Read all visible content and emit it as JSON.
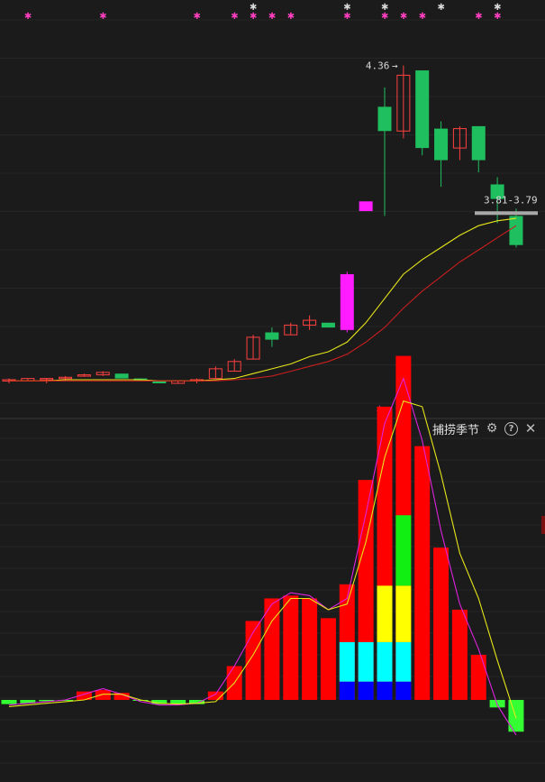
{
  "sub_panel": {
    "title": "捕捞季节"
  },
  "annotations": {
    "high_label": "4.36",
    "range_label": "3.81-3.79"
  },
  "chart_data": [
    {
      "type": "candlestick",
      "ylim": [
        3.05,
        4.5
      ],
      "candles": [
        {
          "o": 3.06,
          "h": 3.07,
          "l": 3.05,
          "c": 3.065
        },
        {
          "o": 3.06,
          "h": 3.07,
          "l": 3.06,
          "c": 3.07
        },
        {
          "o": 3.07,
          "h": 3.07,
          "l": 3.05,
          "c": 3.07
        },
        {
          "o": 3.07,
          "h": 3.08,
          "l": 3.06,
          "c": 3.075
        },
        {
          "o": 3.08,
          "h": 3.09,
          "l": 3.08,
          "c": 3.085
        },
        {
          "o": 3.085,
          "h": 3.1,
          "l": 3.08,
          "c": 3.095
        },
        {
          "o": 3.09,
          "h": 3.09,
          "l": 3.07,
          "c": 3.07
        },
        {
          "o": 3.07,
          "h": 3.07,
          "l": 3.06,
          "c": 3.06
        },
        {
          "o": 3.06,
          "h": 3.06,
          "l": 3.05,
          "c": 3.05
        },
        {
          "o": 3.05,
          "h": 3.06,
          "l": 3.05,
          "c": 3.06
        },
        {
          "o": 3.06,
          "h": 3.07,
          "l": 3.05,
          "c": 3.065
        },
        {
          "o": 3.07,
          "h": 3.12,
          "l": 3.07,
          "c": 3.11
        },
        {
          "o": 3.1,
          "h": 3.15,
          "l": 3.1,
          "c": 3.14
        },
        {
          "o": 3.15,
          "h": 3.25,
          "l": 3.15,
          "c": 3.24
        },
        {
          "o": 3.26,
          "h": 3.28,
          "l": 3.2,
          "c": 3.23
        },
        {
          "o": 3.25,
          "h": 3.3,
          "l": 3.25,
          "c": 3.29
        },
        {
          "o": 3.29,
          "h": 3.33,
          "l": 3.27,
          "c": 3.31
        },
        {
          "o": 3.3,
          "h": 3.29,
          "l": 3.29,
          "c": 3.28
        },
        {
          "o": 3.27,
          "h": 3.51,
          "l": 3.26,
          "c": 3.5,
          "hl": true
        },
        {
          "o": 3.76,
          "h": 3.8,
          "l": 3.76,
          "c": 3.8,
          "hl": true
        },
        {
          "o": 4.19,
          "h": 4.27,
          "l": 3.74,
          "c": 4.09
        },
        {
          "o": 4.09,
          "h": 4.36,
          "l": 4.06,
          "c": 4.32
        },
        {
          "o": 4.34,
          "h": 4.34,
          "l": 3.99,
          "c": 4.02
        },
        {
          "o": 4.1,
          "h": 4.13,
          "l": 3.86,
          "c": 3.97
        },
        {
          "o": 4.02,
          "h": 4.11,
          "l": 3.97,
          "c": 4.1
        },
        {
          "o": 4.11,
          "h": 4.11,
          "l": 3.92,
          "c": 3.97
        },
        {
          "o": 3.87,
          "h": 3.9,
          "l": 3.71,
          "c": 3.81
        },
        {
          "o": 3.74,
          "h": 3.77,
          "l": 3.61,
          "c": 3.62
        }
      ],
      "ma_short": [
        3.06,
        3.06,
        3.06,
        3.065,
        3.065,
        3.065,
        3.065,
        3.065,
        3.06,
        3.06,
        3.06,
        3.065,
        3.07,
        3.09,
        3.11,
        3.13,
        3.16,
        3.18,
        3.22,
        3.3,
        3.4,
        3.5,
        3.56,
        3.61,
        3.66,
        3.7,
        3.72,
        3.73
      ],
      "ma_long": [
        3.06,
        3.06,
        3.06,
        3.06,
        3.06,
        3.06,
        3.06,
        3.06,
        3.06,
        3.06,
        3.06,
        3.06,
        3.065,
        3.07,
        3.08,
        3.1,
        3.12,
        3.14,
        3.17,
        3.22,
        3.28,
        3.36,
        3.43,
        3.49,
        3.55,
        3.6,
        3.65,
        3.7
      ]
    },
    {
      "type": "bar",
      "title": "捕捞季节",
      "ylim": [
        -0.95,
        0.95
      ],
      "values": [
        -0.05,
        -0.04,
        -0.015,
        -0.005,
        0.03,
        0.035,
        0.025,
        -0.01,
        -0.05,
        -0.05,
        -0.05,
        0.03,
        0.12,
        0.28,
        0.36,
        0.37,
        0.36,
        0.29,
        0.41,
        0.78,
        1.04,
        1.22,
        0.9,
        0.54,
        0.32,
        0.16,
        -0.09,
        -0.38
      ],
      "overlay_cyan": [
        0,
        0,
        0,
        0,
        0,
        0,
        0,
        0,
        0,
        0,
        0,
        0,
        0,
        0,
        0,
        0,
        0,
        0,
        0.14,
        0.14,
        0.14,
        0.14,
        0,
        0,
        0,
        0,
        0,
        0
      ],
      "overlay_yellow": [
        0,
        0,
        0,
        0,
        0,
        0,
        0,
        0,
        0,
        0,
        0,
        0,
        0,
        0,
        0,
        0,
        0,
        0,
        0,
        0,
        0.2,
        0.2,
        0,
        0,
        0,
        0,
        0,
        0
      ],
      "overlay_green": [
        0,
        0,
        0,
        0,
        0,
        0,
        0,
        0,
        0,
        0,
        0,
        0,
        0,
        0,
        0,
        0,
        0,
        0,
        0,
        0,
        0,
        0.25,
        0,
        0,
        0,
        0,
        0,
        0
      ],
      "overlay_blue": [
        0,
        0,
        0,
        0,
        0,
        0,
        0,
        0,
        0,
        0,
        0,
        0,
        0,
        0,
        0,
        0,
        0,
        0,
        0.065,
        0.065,
        0.065,
        0.065,
        0,
        0,
        0,
        0,
        0,
        0
      ],
      "line_magenta": [
        -0.06,
        -0.04,
        -0.02,
        0,
        0.02,
        0.04,
        0.02,
        -0.02,
        -0.06,
        -0.06,
        -0.04,
        0.02,
        0.12,
        0.24,
        0.34,
        0.38,
        0.37,
        0.32,
        0.36,
        0.66,
        0.98,
        1.14,
        0.92,
        0.6,
        0.34,
        0.18,
        -0.06,
        -0.42
      ],
      "line_yellow": [
        -0.08,
        -0.06,
        -0.04,
        -0.02,
        0,
        0.02,
        0.02,
        0,
        -0.04,
        -0.05,
        -0.04,
        -0.02,
        0.06,
        0.16,
        0.28,
        0.36,
        0.36,
        0.32,
        0.34,
        0.56,
        0.86,
        1.06,
        1.04,
        0.8,
        0.52,
        0.36,
        0.14,
        -0.22
      ]
    }
  ],
  "colors": {
    "up": "#ff4040",
    "down": "#1fbf5f",
    "highlight": "#ff1cff",
    "ma_short": "#e6e61a",
    "ma_long": "#c81e1e",
    "bar_pos": "#ff0000",
    "bar_neg": "#33ff33",
    "cyan": "#00ffff",
    "yellow": "#ffff00",
    "green": "#11ee11",
    "blue": "#0000ff",
    "line_magenta": "#dd22dd",
    "line_yellow": "#e6e61a",
    "star_pink": "#ff3fbf",
    "star_white": "#d8d8d8"
  },
  "markers": {
    "pink_stars": [
      1,
      5,
      10,
      12,
      13,
      14,
      15,
      18,
      20,
      21,
      22,
      25,
      26
    ],
    "white_stars": [
      13,
      18,
      20,
      23,
      26
    ]
  }
}
